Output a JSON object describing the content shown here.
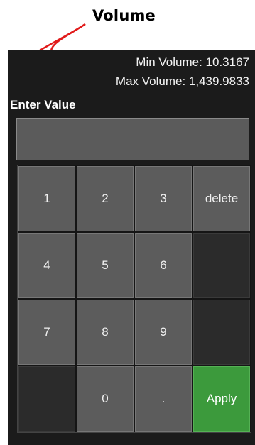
{
  "annotation": {
    "title": "Volume",
    "arrow_color": "#e11b1b"
  },
  "header": {
    "min_volume": "Min Volume: 10.3167",
    "max_volume": "Max Volume: 1,439.9833"
  },
  "input": {
    "label": "Enter Value",
    "value": ""
  },
  "keypad": {
    "keys": [
      {
        "label": "1",
        "name": "key-1",
        "type": "normal"
      },
      {
        "label": "2",
        "name": "key-2",
        "type": "normal"
      },
      {
        "label": "3",
        "name": "key-3",
        "type": "normal"
      },
      {
        "label": "delete",
        "name": "delete-button",
        "type": "normal"
      },
      {
        "label": "4",
        "name": "key-4",
        "type": "normal"
      },
      {
        "label": "5",
        "name": "key-5",
        "type": "normal"
      },
      {
        "label": "6",
        "name": "key-6",
        "type": "normal"
      },
      {
        "label": "",
        "name": "blank-key",
        "type": "blank"
      },
      {
        "label": "7",
        "name": "key-7",
        "type": "normal"
      },
      {
        "label": "8",
        "name": "key-8",
        "type": "normal"
      },
      {
        "label": "9",
        "name": "key-9",
        "type": "normal"
      },
      {
        "label": "",
        "name": "blank-key",
        "type": "blank"
      },
      {
        "label": "",
        "name": "blank-key",
        "type": "blank"
      },
      {
        "label": "0",
        "name": "key-0",
        "type": "normal"
      },
      {
        "label": ".",
        "name": "decimal-key",
        "type": "normal"
      },
      {
        "label": "Apply",
        "name": "apply-button",
        "type": "apply"
      }
    ]
  },
  "colors": {
    "panel_bg": "#1b1b1b",
    "key_bg": "#5c5c5c",
    "blank_key_bg": "#2b2b2b",
    "apply_bg": "#3c9a3c"
  }
}
